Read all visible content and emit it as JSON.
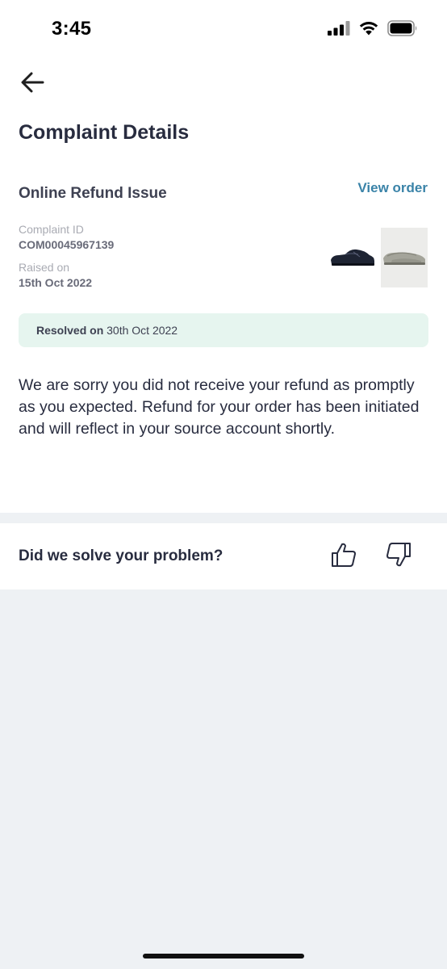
{
  "status_bar": {
    "time": "3:45",
    "icons": [
      "signal-icon",
      "wifi-icon",
      "battery-icon"
    ]
  },
  "header": {
    "back_icon": "arrow-left-icon",
    "title": "Complaint Details"
  },
  "complaint": {
    "type": "Online Refund Issue",
    "view_order_label": "View order",
    "id_label": "Complaint ID",
    "id_value": "COM00045967139",
    "raised_label": "Raised on",
    "raised_value": "15th Oct 2022",
    "product_thumbnails": [
      "black-leather-shoe-image",
      "grey-loafer-image"
    ]
  },
  "resolution": {
    "prefix": "Resolved on",
    "date": "30th Oct 2022",
    "background": "#e6f5ef"
  },
  "message": "We are sorry you did not receive your refund as promptly as you expected. Refund for your order has been initiated and will reflect in your source account shortly.",
  "feedback": {
    "question": "Did we solve your problem?",
    "up_icon": "thumbs-up-icon",
    "down_icon": "thumbs-down-icon"
  },
  "colors": {
    "accent_link": "#3a83a8",
    "page_background": "#eef1f4"
  }
}
